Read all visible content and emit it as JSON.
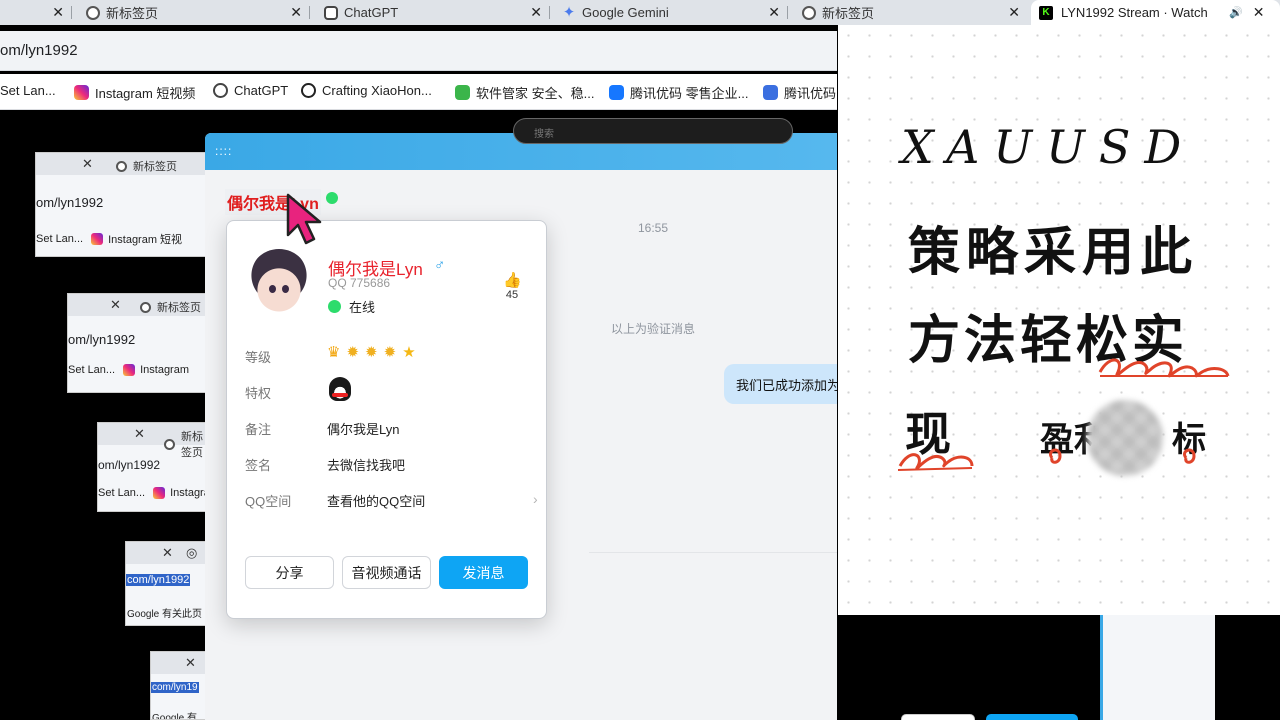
{
  "browser": {
    "tabs": [
      {
        "title": "",
        "icon": "none"
      },
      {
        "title": "新标签页",
        "icon": "chrome-icon"
      },
      {
        "title": "ChatGPT",
        "icon": "chatgpt-icon"
      },
      {
        "title": "Google Gemini",
        "icon": "gemini-icon"
      },
      {
        "title": "新标签页",
        "icon": "chrome-icon"
      },
      {
        "title": "LYN1992 Stream · Watch",
        "icon": "kick-icon"
      }
    ],
    "address": "om/lyn1992",
    "bookmarks": [
      {
        "label": "Set Lan...",
        "icon": "none"
      },
      {
        "label": "Instagram  短视频",
        "icon": "instagram-icon"
      },
      {
        "label": "ChatGPT",
        "icon": "chatgpt-icon"
      },
      {
        "label": "Crafting XiaoHon...",
        "icon": "crafting-icon"
      },
      {
        "label": "软件管家 安全、稳...",
        "icon": "software-manager-icon"
      },
      {
        "label": "腾讯优码 零售企业...",
        "icon": "tencent-youma-icon"
      },
      {
        "label": "腾讯优码",
        "icon": "tencent-youma-icon"
      }
    ]
  },
  "nested": {
    "tab_title": "新标签页",
    "url": "om/lyn1992",
    "url_short": "om/lyn1992",
    "url_selected": "com/lyn1992",
    "url_selected_short": "com/lyn19",
    "set_lang": "Set Lan...",
    "instagram": "Instagram",
    "instagram_short": "Instagra",
    "instagram_full": "Instagram  短视",
    "google_hint": "Google 有关此页",
    "google_hint_short": "Google 有"
  },
  "qq": {
    "chat_name": "偶尔我是Lyn",
    "search_placeholder": "搜索",
    "time": "16:55",
    "verify_notice": "以上为验证消息",
    "message": "我们已成功添加为好友",
    "profile": {
      "name": "偶尔我是Lyn",
      "gender_symbol": "♂",
      "qq": "QQ 775686",
      "status": "在线",
      "likes": "45",
      "rows": {
        "level_label": "等级",
        "privilege_label": "特权",
        "remark_label": "备注",
        "remark_value": "偶尔我是Lyn",
        "signature_label": "签名",
        "signature_value": "去微信找我吧",
        "qzone_label": "QQ空间",
        "qzone_value": "查看他的QQ空间"
      },
      "buttons": {
        "share": "分享",
        "call": "音视频通话",
        "message": "发消息"
      }
    }
  },
  "board": {
    "line1": "XAUUSD",
    "line2": "策略采用此",
    "line3": "方法轻松实",
    "line4_a": "现",
    "line4_b": "盈利",
    "line4_c": "标"
  },
  "colors": {
    "qq_accent": "#0ea5f4",
    "name_red": "#e8232d",
    "online_green": "#2ddc6c",
    "title_bar": "#3aa8e6",
    "annotation_red": "#e0442a"
  }
}
